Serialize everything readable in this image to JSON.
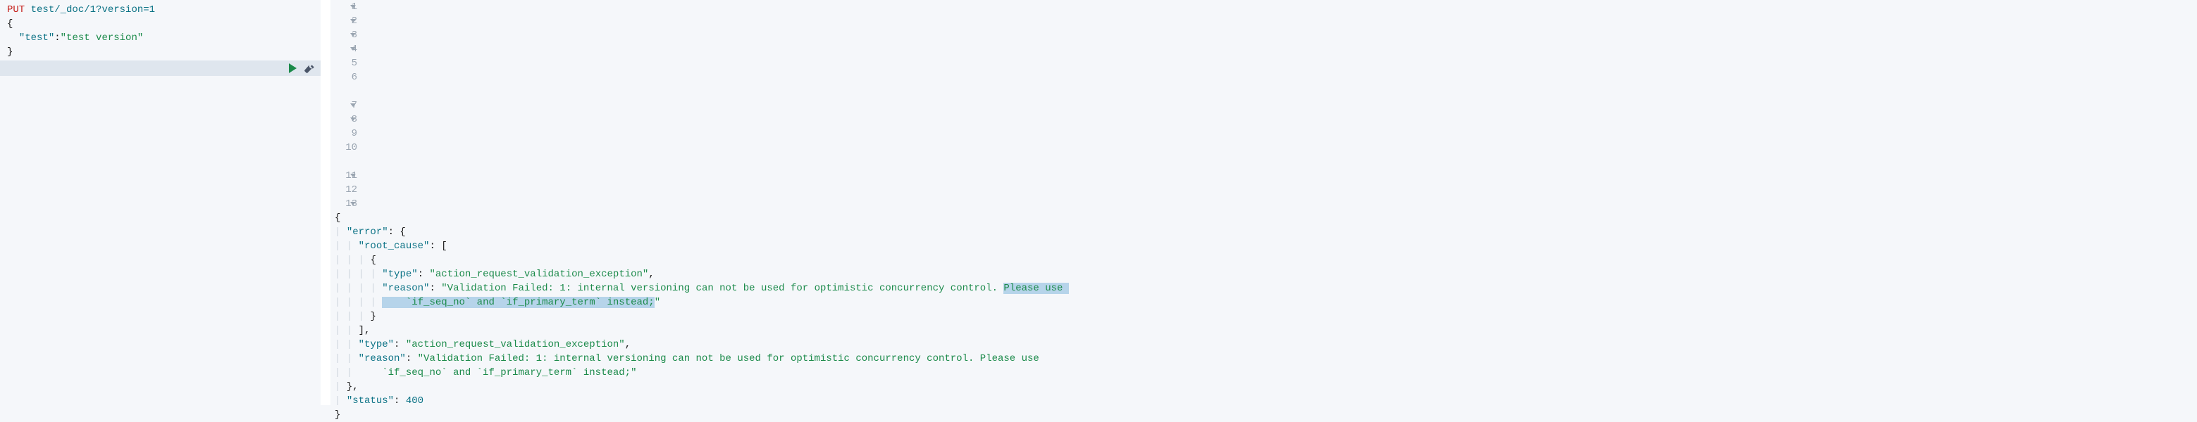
{
  "request": {
    "method": "PUT",
    "path": "test/_doc/1?version=1",
    "body_lines": [
      "{",
      "  \"test\":\"test version\"",
      "}"
    ]
  },
  "actions": {
    "run_label": "Run request",
    "wrench_label": "Options"
  },
  "response": {
    "lines": [
      {
        "n": "1",
        "fold": true,
        "indent": 0,
        "tokens": [
          {
            "t": "{",
            "c": "punc"
          }
        ]
      },
      {
        "n": "2",
        "fold": true,
        "indent": 1,
        "tokens": [
          {
            "t": "\"error\"",
            "c": "key"
          },
          {
            "t": ": {",
            "c": "punc"
          }
        ]
      },
      {
        "n": "3",
        "fold": true,
        "indent": 2,
        "tokens": [
          {
            "t": "\"root_cause\"",
            "c": "key"
          },
          {
            "t": ": [",
            "c": "punc"
          }
        ]
      },
      {
        "n": "4",
        "fold": true,
        "indent": 3,
        "tokens": [
          {
            "t": "{",
            "c": "punc"
          }
        ]
      },
      {
        "n": "5",
        "fold": false,
        "indent": 4,
        "tokens": [
          {
            "t": "\"type\"",
            "c": "key"
          },
          {
            "t": ": ",
            "c": "punc"
          },
          {
            "t": "\"action_request_validation_exception\"",
            "c": "str"
          },
          {
            "t": ",",
            "c": "punc"
          }
        ]
      },
      {
        "n": "6",
        "fold": false,
        "indent": 4,
        "tokens": [
          {
            "t": "\"reason\"",
            "c": "key"
          },
          {
            "t": ": ",
            "c": "punc"
          },
          {
            "t": "\"Validation Failed: 1: internal versioning can not be used for optimistic concurrency control. ",
            "c": "str"
          },
          {
            "t": "Please use ",
            "c": "str",
            "sel": true
          }
        ]
      },
      {
        "n": "",
        "fold": false,
        "indent": 4,
        "wrap": true,
        "tokens": [
          {
            "t": "    `if_seq_no` and `if_primary_term` instead;",
            "c": "str",
            "sel": true
          },
          {
            "t": "\"",
            "c": "str"
          }
        ]
      },
      {
        "n": "7",
        "fold": true,
        "indent": 3,
        "tokens": [
          {
            "t": "}",
            "c": "punc"
          }
        ]
      },
      {
        "n": "8",
        "fold": true,
        "indent": 2,
        "tokens": [
          {
            "t": "],",
            "c": "punc"
          }
        ]
      },
      {
        "n": "9",
        "fold": false,
        "indent": 2,
        "tokens": [
          {
            "t": "\"type\"",
            "c": "key"
          },
          {
            "t": ": ",
            "c": "punc"
          },
          {
            "t": "\"action_request_validation_exception\"",
            "c": "str"
          },
          {
            "t": ",",
            "c": "punc"
          }
        ]
      },
      {
        "n": "10",
        "fold": false,
        "indent": 2,
        "tokens": [
          {
            "t": "\"reason\"",
            "c": "key"
          },
          {
            "t": ": ",
            "c": "punc"
          },
          {
            "t": "\"Validation Failed: 1: internal versioning can not be used for optimistic concurrency control. Please use ",
            "c": "str"
          }
        ]
      },
      {
        "n": "",
        "fold": false,
        "indent": 2,
        "wrap": true,
        "tokens": [
          {
            "t": "    `if_seq_no` and `if_primary_term` instead;\"",
            "c": "str"
          }
        ]
      },
      {
        "n": "11",
        "fold": true,
        "indent": 1,
        "tokens": [
          {
            "t": "},",
            "c": "punc"
          }
        ]
      },
      {
        "n": "12",
        "fold": false,
        "indent": 1,
        "tokens": [
          {
            "t": "\"status\"",
            "c": "key"
          },
          {
            "t": ": ",
            "c": "punc"
          },
          {
            "t": "400",
            "c": "num"
          }
        ]
      },
      {
        "n": "13",
        "fold": true,
        "indent": 0,
        "tokens": [
          {
            "t": "}",
            "c": "punc"
          }
        ]
      }
    ]
  }
}
